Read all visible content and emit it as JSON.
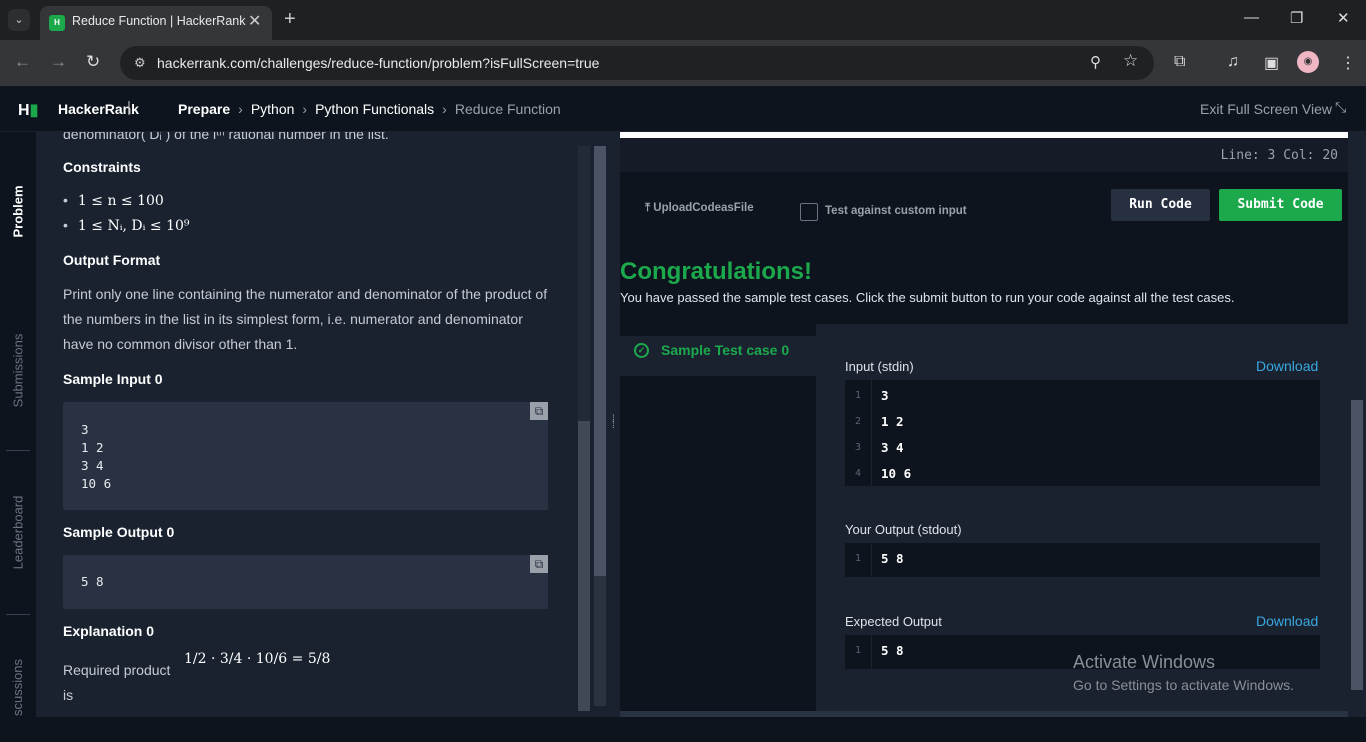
{
  "browser": {
    "tab_title": "Reduce Function | HackerRank",
    "url": "hackerrank.com/challenges/reduce-function/problem?isFullScreen=true"
  },
  "header": {
    "brand": "HackerRank",
    "breadcrumbs": [
      "Prepare",
      "Python",
      "Python Functionals",
      "Reduce Function"
    ],
    "exit_fullscreen": "Exit Full Screen View"
  },
  "side_tabs": [
    "Problem",
    "Submissions",
    "Leaderboard",
    "scussions"
  ],
  "problem": {
    "cut_line": "denominator( Dᵢ ) of the iᵗʰ rational number in the list.",
    "constraints_title": "Constraints",
    "constraints": [
      "1 ≤ n ≤ 100",
      "1 ≤ Nᵢ, Dᵢ ≤ 10⁹"
    ],
    "output_format_title": "Output Format",
    "output_format_text": "Print only one line containing the numerator and denominator of the product of the numbers in the list in its simplest form, i.e. numerator and denominator have no common divisor other than 1.",
    "sample_input_title": "Sample Input 0",
    "sample_input": "3\n1 2\n3 4\n10 6",
    "sample_output_title": "Sample Output 0",
    "sample_output": "5 8",
    "explanation_title": "Explanation 0",
    "explanation_text": "Required product is",
    "explanation_math": "1/2 · 3/4 · 10/6 = 5/8"
  },
  "editor": {
    "line_col": "Line: 3 Col: 20",
    "upload_label": "UploadCodeasFile",
    "custom_input_label": "Test against custom input",
    "run_label": "Run Code",
    "submit_label": "Submit Code"
  },
  "result": {
    "congrats": "Congratulations!",
    "message": "You have passed the sample test cases. Click the submit button to run your code against all the test cases.",
    "testcase_label": "Sample Test case 0",
    "input_label": "Input (stdin)",
    "download_label": "Download",
    "input_lines": [
      "3",
      "1 2",
      "3 4",
      "10 6"
    ],
    "your_output_label": "Your Output (stdout)",
    "your_output": [
      "5 8"
    ],
    "expected_label": "Expected Output",
    "expected_output": [
      "5 8"
    ]
  },
  "watermark": {
    "line1": "Activate Windows",
    "line2": "Go to Settings to activate Windows."
  },
  "colors": {
    "accent_green": "#1ba94c",
    "link_blue": "#39a8e0",
    "background": "#0e141e"
  }
}
